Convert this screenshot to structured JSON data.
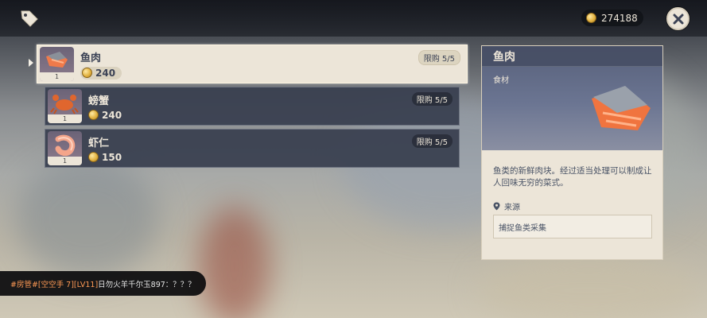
{
  "header": {
    "currency_value": "274188",
    "currency_icon": "mora-coin-icon",
    "close_icon": "close-icon",
    "tag_icon": "price-tag-icon"
  },
  "shop_items": [
    {
      "name": "鱼肉",
      "price": "240",
      "limit": "限购 5/5",
      "qty": "1",
      "selected": true,
      "icon": "fish-meat-icon"
    },
    {
      "name": "螃蟹",
      "price": "240",
      "limit": "限购 5/5",
      "qty": "1",
      "selected": false,
      "icon": "crab-icon"
    },
    {
      "name": "虾仁",
      "price": "150",
      "limit": "限购 5/5",
      "qty": "1",
      "selected": false,
      "icon": "shrimp-icon"
    }
  ],
  "detail": {
    "title": "鱼肉",
    "type": "食材",
    "description": "鱼类的新鲜肉块。经过适当处理可以制成让人回味无穷的菜式。",
    "source_label": "来源",
    "source_value": "捕捉鱼类采集"
  },
  "chat": {
    "tag": "#房管#",
    "user": "[空空手 7][LV11]",
    "message": "日勿火羊千尔玉897：？？？"
  },
  "colors": {
    "panel_cream": "#ece5d8",
    "row_dark": "#373e4e",
    "text_dark": "#3b4255",
    "chat_accent": "#ff9a55"
  }
}
